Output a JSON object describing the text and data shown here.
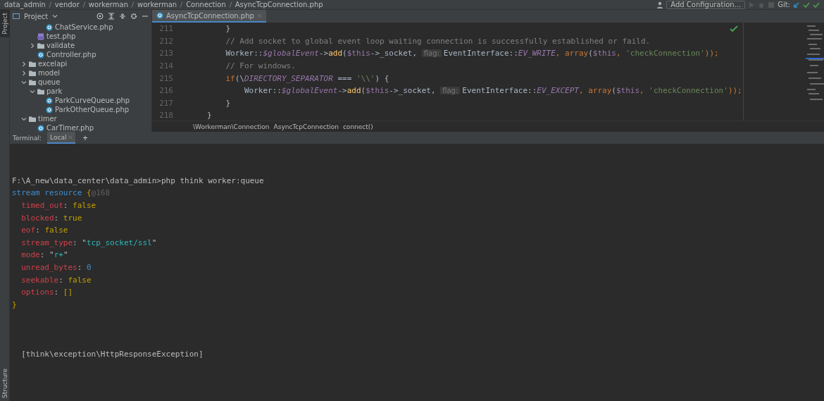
{
  "breadcrumbs": [
    "data_admin",
    "vendor",
    "workerman",
    "workerman",
    "Connection",
    "AsyncTcpConnection.php"
  ],
  "toolbar": {
    "config_button": "Add Configuration...",
    "git_label": "Git:"
  },
  "side_tabs": {
    "top": "Project",
    "bottom": "Structure"
  },
  "project_panel": {
    "title": "Project",
    "tree": [
      {
        "kind": "hidden",
        "children": [
          {
            "kind": "hidden",
            "children": [
              {
                "kind": "class",
                "label": "ChatService.php"
              }
            ]
          },
          {
            "kind": "php",
            "label": "test.php"
          },
          {
            "kind": "folder",
            "label": "validate",
            "expanded": false
          },
          {
            "kind": "class",
            "label": "Controller.php"
          }
        ]
      },
      {
        "kind": "folder",
        "label": "excelapi",
        "expanded": false
      },
      {
        "kind": "folder",
        "label": "model",
        "expanded": false
      },
      {
        "kind": "folder",
        "label": "queue",
        "expanded": true,
        "children": [
          {
            "kind": "folder",
            "label": "park",
            "expanded": true,
            "children": [
              {
                "kind": "class",
                "label": "ParkCurveQueue.php"
              },
              {
                "kind": "class",
                "label": "ParkOtherQueue.php"
              }
            ]
          }
        ]
      },
      {
        "kind": "folder",
        "label": "timer",
        "expanded": true,
        "children": [
          {
            "kind": "class",
            "label": "CarTimer.php"
          }
        ]
      }
    ]
  },
  "editor": {
    "tabs": [
      {
        "label": "AsyncTcpConnection.php",
        "selected": true
      }
    ],
    "lines": [
      {
        "number": "211",
        "tokens": [
          {
            "kind": "plain",
            "text": "    }"
          }
        ]
      },
      {
        "number": "212",
        "tokens": [
          {
            "kind": "comment",
            "text": "    // Add socket to global event loop waiting connection is successfully established or faild."
          }
        ]
      },
      {
        "number": "213",
        "tokens": [
          {
            "kind": "plain",
            "text": "    Worker::"
          },
          {
            "kind": "static",
            "text": "$globalEvent"
          },
          {
            "kind": "plain",
            "text": "->"
          },
          {
            "kind": "func",
            "text": "add"
          },
          {
            "kind": "plain",
            "text": "("
          },
          {
            "kind": "var",
            "text": "$this"
          },
          {
            "kind": "plain",
            "text": "->_socket, "
          },
          {
            "kind": "hint",
            "text": "flag:"
          },
          {
            "kind": "plain",
            "text": "EventInterface::"
          },
          {
            "kind": "static",
            "text": "EV_WRITE"
          },
          {
            "kind": "keyword",
            "text": ", array"
          },
          {
            "kind": "plain",
            "text": "("
          },
          {
            "kind": "var",
            "text": "$this"
          },
          {
            "kind": "keyword",
            "text": ", "
          },
          {
            "kind": "string",
            "text": "'checkConnection'"
          },
          {
            "kind": "keyword",
            "text": "));"
          }
        ]
      },
      {
        "number": "214",
        "tokens": [
          {
            "kind": "comment",
            "text": "    // For windows."
          }
        ]
      },
      {
        "number": "215",
        "tokens": [
          {
            "kind": "keyword",
            "text": "    if"
          },
          {
            "kind": "plain",
            "text": "(\\"
          },
          {
            "kind": "static",
            "text": "DIRECTORY_SEPARATOR"
          },
          {
            "kind": "plain",
            "text": " === "
          },
          {
            "kind": "string",
            "text": "'\\\\'"
          },
          {
            "kind": "plain",
            "text": ") {"
          }
        ]
      },
      {
        "number": "216",
        "tokens": [
          {
            "kind": "plain",
            "text": "        Worker::"
          },
          {
            "kind": "static",
            "text": "$globalEvent"
          },
          {
            "kind": "plain",
            "text": "->"
          },
          {
            "kind": "func",
            "text": "add"
          },
          {
            "kind": "plain",
            "text": "("
          },
          {
            "kind": "var",
            "text": "$this"
          },
          {
            "kind": "plain",
            "text": "->_socket, "
          },
          {
            "kind": "hint",
            "text": "flag:"
          },
          {
            "kind": "plain",
            "text": "EventInterface::"
          },
          {
            "kind": "static",
            "text": "EV_EXCEPT"
          },
          {
            "kind": "keyword",
            "text": ", array"
          },
          {
            "kind": "plain",
            "text": "("
          },
          {
            "kind": "var",
            "text": "$this"
          },
          {
            "kind": "keyword",
            "text": ", "
          },
          {
            "kind": "string",
            "text": "'checkConnection'"
          },
          {
            "kind": "keyword",
            "text": "));"
          }
        ]
      },
      {
        "number": "217",
        "tokens": [
          {
            "kind": "plain",
            "text": "    }"
          }
        ]
      },
      {
        "number": "218",
        "tokens": [
          {
            "kind": "plain",
            "text": "}"
          }
        ]
      }
    ],
    "path": [
      "\\Workerman\\Connection",
      "AsyncTcpConnection",
      "connect()"
    ]
  },
  "terminal": {
    "label": "Terminal:",
    "tabs": [
      {
        "label": "Local",
        "selected": true
      }
    ],
    "add": "+",
    "lines": [
      {
        "kind": "blank"
      },
      {
        "kind": "text",
        "tokens": [
          {
            "kind": "plain",
            "text": "F:\\A_new\\data_center\\data_admin>php think worker:queue"
          }
        ]
      },
      {
        "kind": "text",
        "tokens": [
          {
            "kind": "type",
            "text": "stream resource "
          },
          {
            "kind": "bool",
            "text": "{"
          },
          {
            "kind": "dim",
            "text": "@168"
          }
        ]
      },
      {
        "kind": "text",
        "tokens": [
          {
            "kind": "key",
            "text": "  timed_out"
          },
          {
            "kind": "plain",
            "text": ": "
          },
          {
            "kind": "bool",
            "text": "false"
          }
        ]
      },
      {
        "kind": "text",
        "tokens": [
          {
            "kind": "key",
            "text": "  blocked"
          },
          {
            "kind": "plain",
            "text": ": "
          },
          {
            "kind": "bool",
            "text": "true"
          }
        ]
      },
      {
        "kind": "text",
        "tokens": [
          {
            "kind": "key",
            "text": "  eof"
          },
          {
            "kind": "plain",
            "text": ": "
          },
          {
            "kind": "bool",
            "text": "false"
          }
        ]
      },
      {
        "kind": "text",
        "tokens": [
          {
            "kind": "key",
            "text": "  stream_type"
          },
          {
            "kind": "plain",
            "text": ": \""
          },
          {
            "kind": "str",
            "text": "tcp_socket/ssl"
          },
          {
            "kind": "plain",
            "text": "\""
          }
        ]
      },
      {
        "kind": "text",
        "tokens": [
          {
            "kind": "key",
            "text": "  mode"
          },
          {
            "kind": "plain",
            "text": ": \""
          },
          {
            "kind": "str",
            "text": "r+"
          },
          {
            "kind": "plain",
            "text": "\""
          }
        ]
      },
      {
        "kind": "text",
        "tokens": [
          {
            "kind": "key",
            "text": "  unread_bytes"
          },
          {
            "kind": "plain",
            "text": ": "
          },
          {
            "kind": "num",
            "text": "0"
          }
        ]
      },
      {
        "kind": "text",
        "tokens": [
          {
            "kind": "key",
            "text": "  seekable"
          },
          {
            "kind": "plain",
            "text": ": "
          },
          {
            "kind": "bool",
            "text": "false"
          }
        ]
      },
      {
        "kind": "text",
        "tokens": [
          {
            "kind": "key",
            "text": "  options"
          },
          {
            "kind": "plain",
            "text": ": "
          },
          {
            "kind": "bool",
            "text": "[]"
          }
        ]
      },
      {
        "kind": "text",
        "tokens": [
          {
            "kind": "bool",
            "text": "}"
          }
        ]
      },
      {
        "kind": "blank"
      },
      {
        "kind": "blank"
      },
      {
        "kind": "blank"
      },
      {
        "kind": "text",
        "tokens": [
          {
            "kind": "plain",
            "text": "  [think\\exception\\HttpResponseException]"
          }
        ]
      }
    ]
  }
}
